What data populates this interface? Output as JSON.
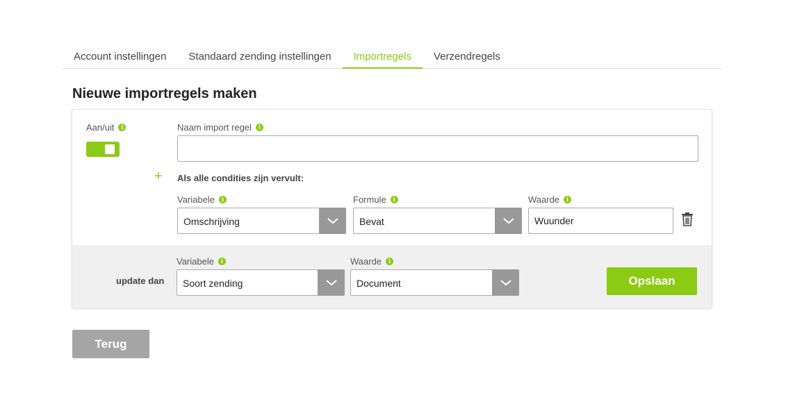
{
  "tabs": [
    {
      "label": "Account instellingen",
      "active": false
    },
    {
      "label": "Standaard zending instellingen",
      "active": false
    },
    {
      "label": "Importregels",
      "active": true
    },
    {
      "label": "Verzendregels",
      "active": false
    }
  ],
  "page_title": "Nieuwe importregels maken",
  "rule": {
    "onoff_label": "Aan/uit",
    "onoff_state": true,
    "name_label": "Naam import regel",
    "name_value": "",
    "conditions_title": "Als alle condities zijn vervult:",
    "add_icon": "plus-icon",
    "condition": {
      "variable_label": "Variabele",
      "variable_value": "Omschrijving",
      "formula_label": "Formule",
      "formula_value": "Bevat",
      "value_label": "Waarde",
      "value_value": "Wuunder",
      "delete_icon": "trash-icon"
    }
  },
  "update": {
    "label": "update dan",
    "variable_label": "Variabele",
    "variable_value": "Soort zending",
    "value_label": "Waarde",
    "value_value": "Document"
  },
  "buttons": {
    "save": "Opslaan",
    "back": "Terug"
  },
  "info_icon_glyph": "i",
  "colors": {
    "accent": "#8ccb13",
    "select_arrow_bg": "#999999",
    "back_button": "#a5a5a5",
    "bottom_panel": "#f0f0f0"
  }
}
